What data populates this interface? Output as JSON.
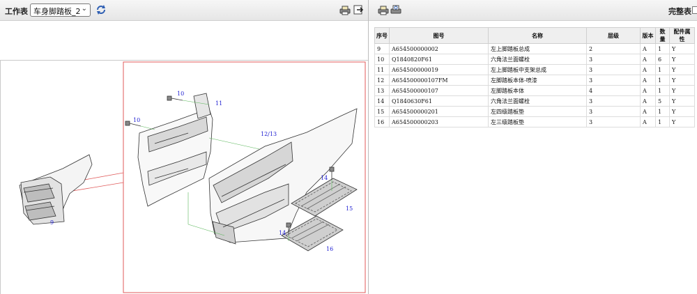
{
  "left_toolbar": {
    "label": "工作表",
    "select_value": "车身脚踏板_2"
  },
  "right_toolbar": {
    "complete_label": "完整表"
  },
  "drawing": {
    "callouts": [
      "9",
      "10",
      "10",
      "11",
      "12/13",
      "14",
      "14",
      "15",
      "16"
    ]
  },
  "table": {
    "headers": [
      "序号",
      "图号",
      "名称",
      "层级",
      "版本",
      "数量",
      "配件属性"
    ],
    "rows": [
      [
        "9",
        "A654500000002",
        "左上脚踏板总成",
        "2",
        "A",
        "1",
        "Y"
      ],
      [
        "10",
        "Q1840820F61",
        "六角法兰面螺栓",
        "3",
        "A",
        "6",
        "Y"
      ],
      [
        "11",
        "A654500000019",
        "左上脚踏板中支架总成",
        "3",
        "A",
        "1",
        "Y"
      ],
      [
        "12",
        "A654500000107FM",
        "左脚踏板本体-喷漆",
        "3",
        "A",
        "1",
        "Y"
      ],
      [
        "13",
        "A654500000107",
        "左脚踏板本体",
        "4",
        "A",
        "1",
        "Y"
      ],
      [
        "14",
        "Q1840630F61",
        "六角法兰面螺栓",
        "3",
        "A",
        "5",
        "Y"
      ],
      [
        "15",
        "A654500000201",
        "左四级踏板垫",
        "3",
        "A",
        "1",
        "Y"
      ],
      [
        "16",
        "A654500000203",
        "左三级踏板垫",
        "3",
        "A",
        "1",
        "Y"
      ]
    ]
  }
}
